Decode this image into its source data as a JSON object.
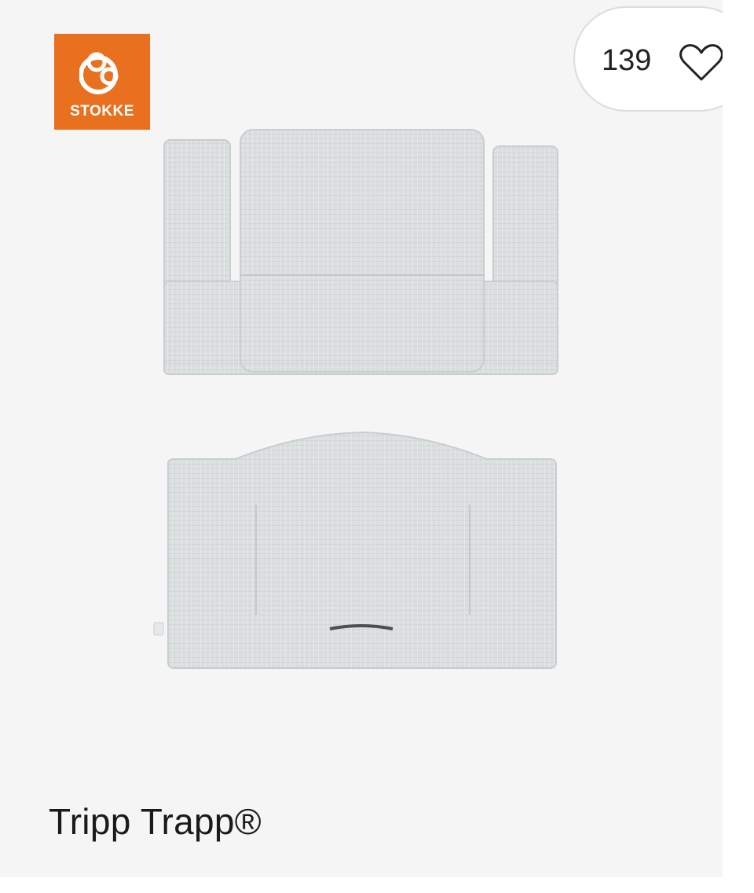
{
  "brand": {
    "name": "STOKKE",
    "color": "#e8701e"
  },
  "likes": {
    "count": "139",
    "icon": "heart-outline-icon"
  },
  "product": {
    "title": "Tripp Trapp®",
    "image_alt": "Tripp Trapp cushion set – backrest and seat cushion in light grey",
    "cushion_color": "#dcdfe0"
  }
}
